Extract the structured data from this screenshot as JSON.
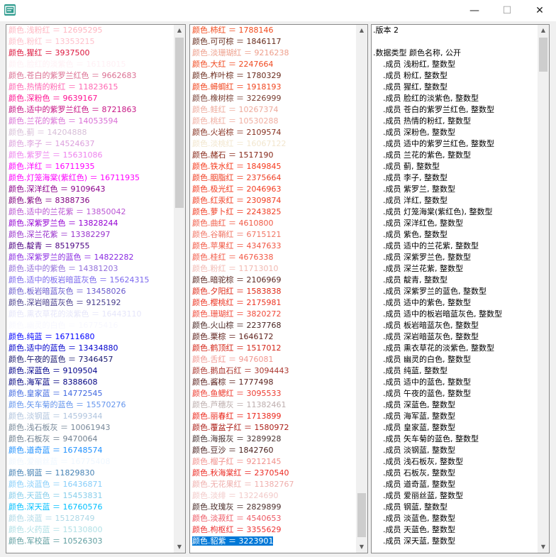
{
  "window": {
    "minimize_glyph": "—",
    "maximize_glyph": "☐",
    "close_glyph": "✕"
  },
  "left_list": [
    {
      "text": "颜色.浅粉红 ＝ 12695295",
      "color": "#ffb6c1"
    },
    {
      "text": "颜色.粉红 ＝ 13353215",
      "color": "#ffc0cb"
    },
    {
      "text": "颜色.猩红 ＝ 3937500",
      "color": "#dc143c"
    },
    {
      "text": "颜色.脸红的淡紫色 ＝ 16118015",
      "color": "#fff0f5"
    },
    {
      "text": "颜色.苍白的紫罗兰红色 ＝ 9662683",
      "color": "#db7093"
    },
    {
      "text": "颜色.热情的粉红 ＝ 11823615",
      "color": "#ff69b4"
    },
    {
      "text": "颜色.深粉色 ＝ 9639167",
      "color": "#ff1493"
    },
    {
      "text": "颜色.适中的紫罗兰红色 ＝ 8721863",
      "color": "#c71585"
    },
    {
      "text": "颜色.兰花的紫色 ＝ 14053594",
      "color": "#da70d6"
    },
    {
      "text": "颜色.蓟 ＝ 14204888",
      "color": "#d8bfd8"
    },
    {
      "text": "颜色.李子 ＝ 14524637",
      "color": "#dda0dd"
    },
    {
      "text": "颜色.紫罗兰 ＝ 15631086",
      "color": "#ee82ee"
    },
    {
      "text": "颜色.洋红 ＝ 16711935",
      "color": "#ff00ff"
    },
    {
      "text": "颜色.灯笼海棠(紫红色) ＝ 16711935",
      "color": "#ff00ff"
    },
    {
      "text": "颜色.深洋红色 ＝ 9109643",
      "color": "#8b008b"
    },
    {
      "text": "颜色.紫色 ＝ 8388736",
      "color": "#800080"
    },
    {
      "text": "颜色.适中的兰花紫 ＝ 13850042",
      "color": "#ba55d3"
    },
    {
      "text": "颜色.深紫罗兰色 ＝ 13828244",
      "color": "#9400d3"
    },
    {
      "text": "颜色.深兰花紫 ＝ 13382297",
      "color": "#9932cc"
    },
    {
      "text": "颜色.靛青 ＝ 8519755",
      "color": "#4b0082"
    },
    {
      "text": "颜色.深紫罗兰的蓝色 ＝ 14822282",
      "color": "#8a2be2"
    },
    {
      "text": "颜色.适中的紫色 ＝ 14381203",
      "color": "#9370db"
    },
    {
      "text": "颜色.适中的板岩暗蓝灰色 ＝ 15624315",
      "color": "#7b68ee"
    },
    {
      "text": "颜色.板岩暗蓝灰色 ＝ 13458026",
      "color": "#6a5acd"
    },
    {
      "text": "颜色.深岩暗蓝灰色 ＝ 9125192",
      "color": "#483d8b"
    },
    {
      "text": "颜色.熏衣草花的淡紫色 ＝ 16443110",
      "color": "#e6e6fa"
    },
    {
      "text": "颜色.幽灵的白色 ＝ 16775416",
      "color": "#f8f8ff"
    },
    {
      "text": "颜色.纯蓝 ＝ 16711680",
      "color": "#0000ff"
    },
    {
      "text": "颜色.适中的蓝色 ＝ 13434880",
      "color": "#0000cd"
    },
    {
      "text": "颜色.午夜的蓝色 ＝ 7346457",
      "color": "#191970"
    },
    {
      "text": "颜色.深蓝色 ＝ 9109504",
      "color": "#00008b"
    },
    {
      "text": "颜色.海军蓝 ＝ 8388608",
      "color": "#000080"
    },
    {
      "text": "颜色.皇家蓝 ＝ 14772545",
      "color": "#4169e1"
    },
    {
      "text": "颜色.矢车菊的蓝色 ＝ 15570276",
      "color": "#6495ed"
    },
    {
      "text": "颜色.淡钢蓝 ＝ 14599344",
      "color": "#b0c4de"
    },
    {
      "text": "颜色.浅石板灰 ＝ 10061943",
      "color": "#778899"
    },
    {
      "text": "颜色.石板灰 ＝ 9470064",
      "color": "#708090"
    },
    {
      "text": "颜色.道奇蓝 ＝ 16748574",
      "color": "#1e90ff"
    },
    {
      "text": "颜色.爱丽丝蓝 ＝ 16775408",
      "color": "#f0f8ff"
    },
    {
      "text": "颜色.钢蓝 ＝ 11829830",
      "color": "#4682b4"
    },
    {
      "text": "颜色.淡蓝色 ＝ 16436871",
      "color": "#87cefa"
    },
    {
      "text": "颜色.天蓝色 ＝ 15453831",
      "color": "#87ceeb"
    },
    {
      "text": "颜色.深天蓝 ＝ 16760576",
      "color": "#00bfff"
    },
    {
      "text": "颜色.淡蓝 ＝ 15128749",
      "color": "#add8e6"
    },
    {
      "text": "颜色.火药蓝 ＝ 15130800",
      "color": "#b0e0e6"
    },
    {
      "text": "颜色.军校蓝 ＝ 10526303",
      "color": "#5f9ea0"
    }
  ],
  "middle_list": [
    {
      "text": "颜色.柿红 ＝ 1788146",
      "color": "#f2491b"
    },
    {
      "text": "颜色.可可棕 ＝ 1846117",
      "color": "#652b1c"
    },
    {
      "text": "颜色.淡珊瑚红 ＝ 9216238",
      "color": "#ee9f8c"
    },
    {
      "text": "颜色.大红 ＝ 2247664",
      "color": "#f04b22"
    },
    {
      "text": "颜色.柞叶棕 ＝ 1780329",
      "color": "#692a1b"
    },
    {
      "text": "颜色.蟳蜩红 ＝ 1918193",
      "color": "#f1441d"
    },
    {
      "text": "颜色.橡树棕 ＝ 3226999",
      "color": "#773d31"
    },
    {
      "text": "颜色.鲑红 ＝ 10267374",
      "color": "#eeaa9c"
    },
    {
      "text": "颜色.桃红 ＝ 10530288",
      "color": "#f0ada0"
    },
    {
      "text": "颜色.火岩棕 ＝ 2109574",
      "color": "#863020"
    },
    {
      "text": "颜色.淡桃红 ＝ 16067122",
      "color": "#f2e6ce"
    },
    {
      "text": "颜色.赭石 ＝ 1517190",
      "color": "#862617"
    },
    {
      "text": "颜色.铁水红 ＝ 1849845",
      "color": "#f5391c"
    },
    {
      "text": "颜色.胭脂红 ＝ 2375664",
      "color": "#f03f24"
    },
    {
      "text": "颜色.极光红 ＝ 2046963",
      "color": "#f33b1f"
    },
    {
      "text": "颜色.红汞红 ＝ 2309874",
      "color": "#f23e23"
    },
    {
      "text": "颜色.萝卜红 ＝ 2243825",
      "color": "#f13c22"
    },
    {
      "text": "颜色.曲红 ＝ 4610800",
      "color": "#f05a46"
    },
    {
      "text": "颜色.谷鞘红 ＝ 6715121",
      "color": "#f17666"
    },
    {
      "text": "颜色.苹果红 ＝ 4347633",
      "color": "#f15642"
    },
    {
      "text": "颜色.桂红 ＝ 4676338",
      "color": "#f25a47"
    },
    {
      "text": "颜色.粉红 ＝ 11713010",
      "color": "#f2b9b2"
    },
    {
      "text": "颜色.暗驼棕 ＝ 2106969",
      "color": "#592620"
    },
    {
      "text": "颜色.夕阳红 ＝ 1583838",
      "color": "#de2a18"
    },
    {
      "text": "颜色.樱桃红 ＝ 2175981",
      "color": "#ed3321"
    },
    {
      "text": "颜色.珊瑚红 ＝ 3820272",
      "color": "#f04a3a"
    },
    {
      "text": "颜色.火山棕 ＝ 2237768",
      "color": "#482522"
    },
    {
      "text": "颜色.栗棕 ＝ 1646172",
      "color": "#5c1e19"
    },
    {
      "text": "颜色.鹤顶红 ＝ 1517012",
      "color": "#d42517"
    },
    {
      "text": "颜色.舌红 ＝ 9476081",
      "color": "#f19790"
    },
    {
      "text": "颜色.鹅血石红 ＝ 3094443",
      "color": "#ab372f"
    },
    {
      "text": "颜色.酱棕 ＝ 1777498",
      "color": "#5a1f1b"
    },
    {
      "text": "颜色.鱼鳃红 ＝ 3095533",
      "color": "#ed3b2f"
    },
    {
      "text": "颜色.芦穗灰 ＝ 11382461",
      "color": "#bdaead"
    },
    {
      "text": "颜色.丽春红 ＝ 1713899",
      "color": "#eb261a"
    },
    {
      "text": "颜色.覆盆子红 ＝ 1580972",
      "color": "#ac1f18"
    },
    {
      "text": "颜色.海报灰 ＝ 3289928",
      "color": "#483332"
    },
    {
      "text": "颜色.豆沙 ＝ 1842760",
      "color": "#481e1c"
    },
    {
      "text": "颜色.榴子红 ＝ 9212145",
      "color": "#f1908c"
    },
    {
      "text": "颜色.秋海棠红 ＝ 2370540",
      "color": "#ec2b24"
    },
    {
      "text": "颜色.无花果红 ＝ 11382767",
      "color": "#efafad"
    },
    {
      "text": "颜色.淡绯 ＝ 13224690",
      "color": "#f2cac9"
    },
    {
      "text": "颜色.玫瑰灰 ＝ 2829899",
      "color": "#4b2e2b"
    },
    {
      "text": "颜色.淡菽红 ＝ 4540653",
      "color": "#ed5a65"
    },
    {
      "text": "颜色.枸枢红 ＝ 3355629",
      "color": "#ed3333"
    },
    {
      "text": "颜色.貂紫 ＝ 3223901",
      "color": "#5d3131",
      "selected": true
    }
  ],
  "right_list": [
    ".版本 2",
    "",
    ".数据类型 颜色名称, 公开",
    "    .成员 浅粉红, 整数型",
    "    .成员 粉红, 整数型",
    "    .成员 猩红, 整数型",
    "    .成员 脸红的淡紫色, 整数型",
    "    .成员 苍白的紫罗兰红色, 整数型",
    "    .成员 热情的粉红, 整数型",
    "    .成员 深粉色, 整数型",
    "    .成员 适中的紫罗兰红色, 整数型",
    "    .成员 兰花的紫色, 整数型",
    "    .成员 蓟, 整数型",
    "    .成员 李子, 整数型",
    "    .成员 紫罗兰, 整数型",
    "    .成员 洋红, 整数型",
    "    .成员 灯笼海棠(紫红色), 整数型",
    "    .成员 深洋红色, 整数型",
    "    .成员 紫色, 整数型",
    "    .成员 适中的兰花紫, 整数型",
    "    .成员 深紫罗兰色, 整数型",
    "    .成员 深兰花紫, 整数型",
    "    .成员 靛青, 整数型",
    "    .成员 深紫罗兰的蓝色, 整数型",
    "    .成员 适中的紫色, 整数型",
    "    .成员 适中的板岩暗蓝灰色, 整数型",
    "    .成员 板岩暗蓝灰色, 整数型",
    "    .成员 深岩暗蓝灰色, 整数型",
    "    .成员 熏衣草花的淡紫色, 整数型",
    "    .成员 幽灵的白色, 整数型",
    "    .成员 纯蓝, 整数型",
    "    .成员 适中的蓝色, 整数型",
    "    .成员 午夜的蓝色, 整数型",
    "    .成员 深蓝色, 整数型",
    "    .成员 海军蓝, 整数型",
    "    .成员 皇家蓝, 整数型",
    "    .成员 矢车菊的蓝色, 整数型",
    "    .成员 淡钢蓝, 整数型",
    "    .成员 浅石板灰, 整数型",
    "    .成员 石板灰, 整数型",
    "    .成员 道奇蓝, 整数型",
    "    .成员 爱丽丝蓝, 整数型",
    "    .成员 钢蓝, 整数型",
    "    .成员 淡蓝色, 整数型",
    "    .成员 天蓝色, 整数型",
    "    .成员 深天蓝, 整数型"
  ]
}
